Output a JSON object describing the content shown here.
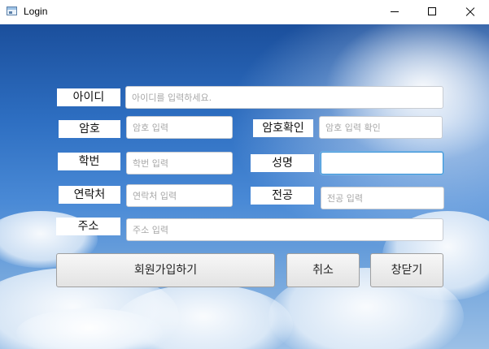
{
  "window": {
    "title": "Login"
  },
  "form": {
    "id_label": "아이디",
    "id_placeholder": "아이디를 입력하세요.",
    "pw_label": "암호",
    "pw_placeholder": "암호 입력",
    "pw_confirm_label": "암호확인",
    "pw_confirm_placeholder": "암호 입력 확인",
    "student_no_label": "학번",
    "student_no_placeholder": "학번 입력",
    "name_label": "성명",
    "name_value": "",
    "contact_label": "연락처",
    "contact_placeholder": "연락처 입력",
    "major_label": "전공",
    "major_placeholder": "전공 입력",
    "address_label": "주소",
    "address_placeholder": "주소 입력"
  },
  "buttons": {
    "signup_label": "회원가입하기",
    "cancel_label": "취소",
    "close_label": "창닫기"
  },
  "icons": {
    "app": "window-app-icon",
    "minimize": "minimize-icon",
    "maximize": "maximize-icon",
    "close": "close-icon"
  }
}
